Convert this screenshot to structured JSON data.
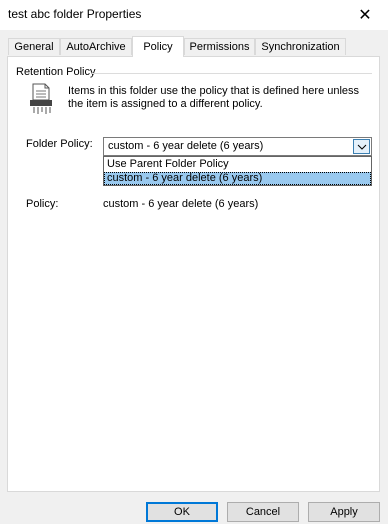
{
  "window": {
    "title": "test abc folder Properties"
  },
  "tabs": [
    "General",
    "AutoArchive",
    "Policy",
    "Permissions",
    "Synchronization"
  ],
  "group": {
    "label": "Retention Policy"
  },
  "info_text": "Items in this folder use the policy that is defined here unless the item is assigned to a different policy.",
  "folder_policy": {
    "label": "Folder Policy:",
    "selected": "custom - 6 year delete (6 years)",
    "options": [
      "Use Parent Folder Policy",
      "custom - 6 year delete (6 years)"
    ],
    "highlighted_index": 1
  },
  "policy": {
    "label": "Policy:",
    "value": "custom - 6 year delete (6 years)"
  },
  "buttons": {
    "ok": "OK",
    "cancel": "Cancel",
    "apply": "Apply"
  },
  "colors": {
    "selection": "#99c9ef",
    "accent": "#0078d7"
  }
}
